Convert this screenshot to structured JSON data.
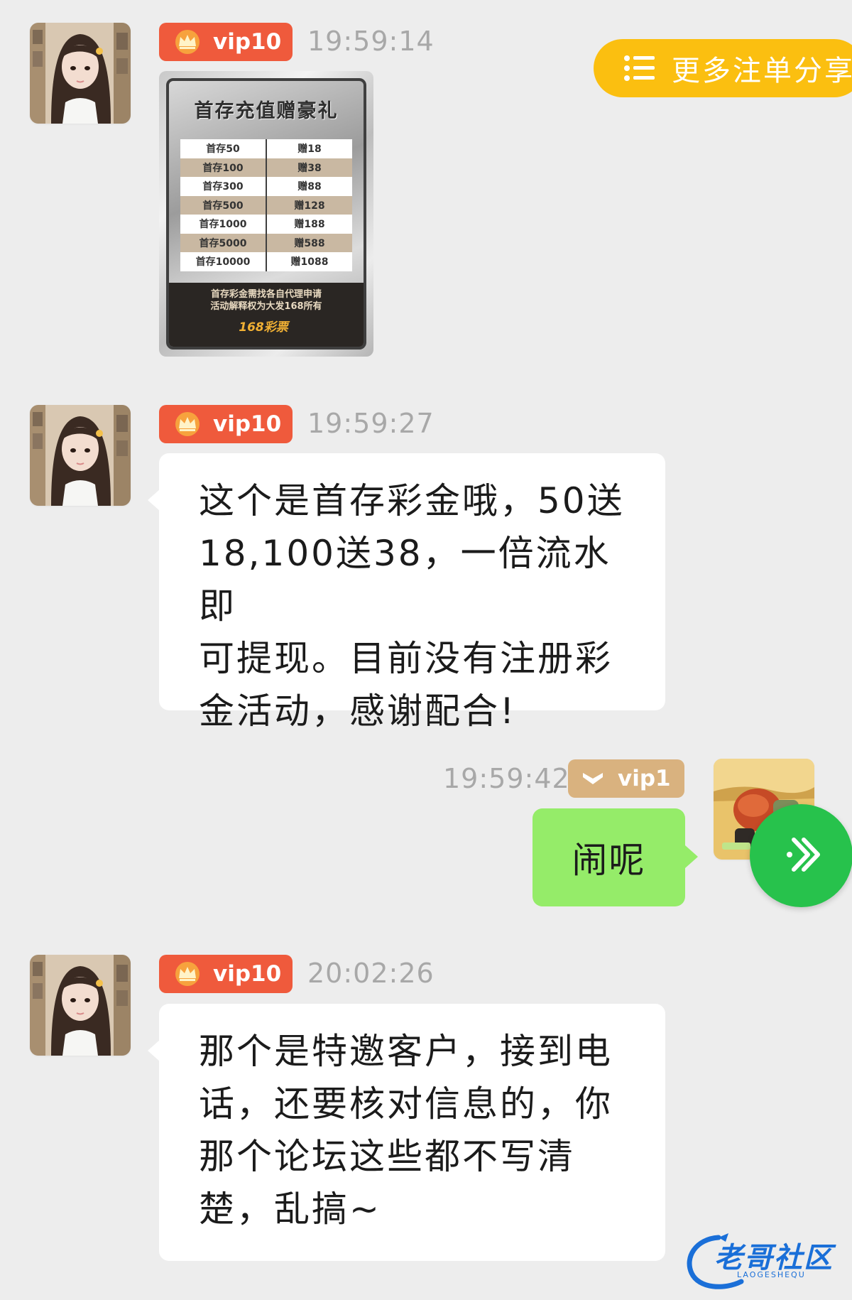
{
  "share_button": {
    "label": "更多注单分享",
    "icon": "list-icon",
    "color": "#fbbf10"
  },
  "colors": {
    "background": "#ededed",
    "vip_high": "#ef5a3c",
    "vip_low": "#d9b27f",
    "bubble_mine": "#95ec69",
    "fab": "#27c24c"
  },
  "messages": [
    {
      "sender": "other",
      "vip": "vip10",
      "time": "19:59:14",
      "type": "image",
      "promo": {
        "title": "首存充值赠豪礼",
        "rows": [
          [
            "首存50",
            "赠18"
          ],
          [
            "首存100",
            "赠38"
          ],
          [
            "首存300",
            "赠88"
          ],
          [
            "首存500",
            "赠128"
          ],
          [
            "首存1000",
            "赠188"
          ],
          [
            "首存5000",
            "赠588"
          ],
          [
            "首存10000",
            "赠1088"
          ]
        ],
        "note_line1": "首存彩金需找各自代理申请",
        "note_line2": "活动解释权为大发168所有",
        "logo": "168彩票"
      }
    },
    {
      "sender": "other",
      "vip": "vip10",
      "time": "19:59:27",
      "type": "text",
      "lines": [
        "这个是首存彩金哦，50送",
        "18,100送38，一倍流水即",
        "可提现。目前没有注册彩",
        "金活动，感谢配合!"
      ]
    },
    {
      "sender": "me",
      "vip": "vip1",
      "time": "19:59:42",
      "type": "text",
      "text": "闹呢"
    },
    {
      "sender": "other",
      "vip": "vip10",
      "time": "20:02:26",
      "type": "text",
      "lines": [
        "那个是特邀客户，接到电",
        "话，还要核对信息的，你",
        "那个论坛这些都不写清",
        "楚，乱搞~"
      ]
    }
  ],
  "fab": {
    "icon": "forward-arrows-icon"
  },
  "watermark": {
    "title": "老哥社区",
    "subtitle": "LAOGESHEQU"
  }
}
